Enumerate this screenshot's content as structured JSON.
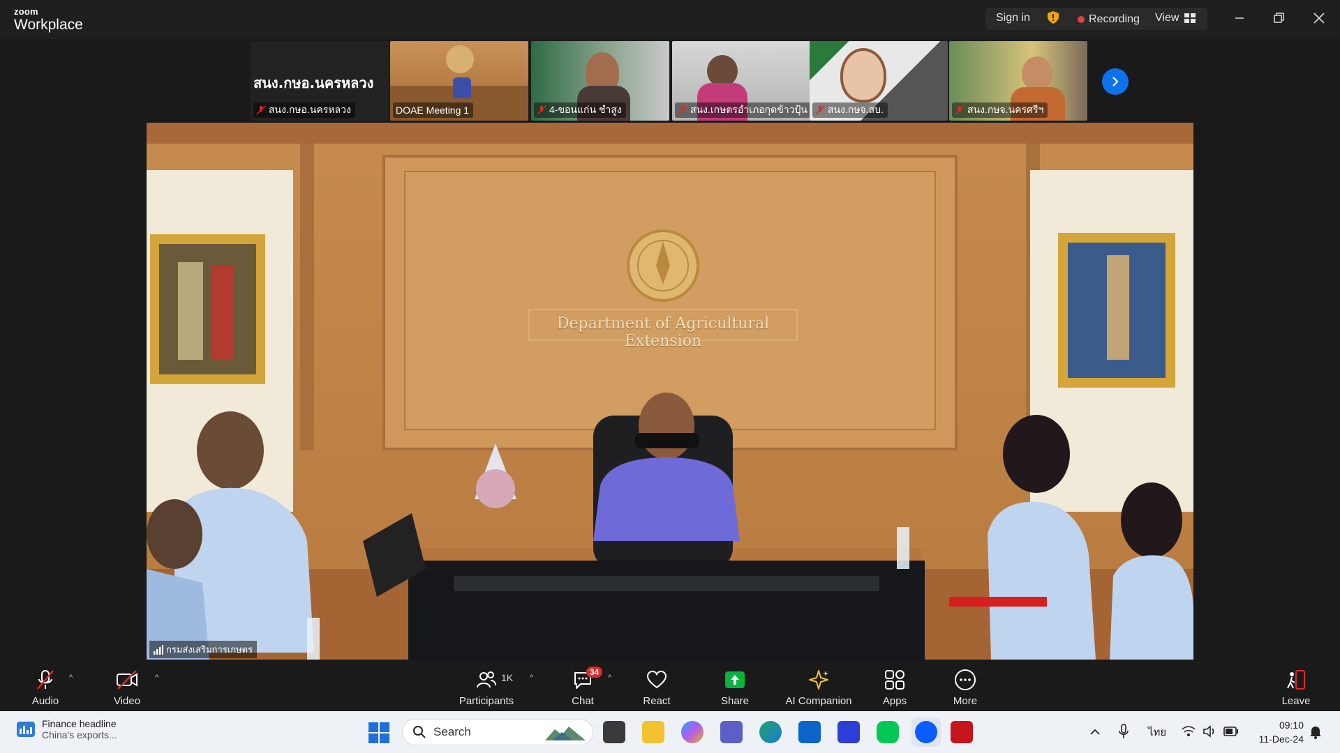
{
  "titlebar": {
    "logo_small": "zoom",
    "logo_big": "Workplace",
    "sign_in": "Sign in",
    "recording": "Recording",
    "view": "View"
  },
  "thumbnails": [
    {
      "name": "สนง.กษอ.นครหลวง",
      "banner": "สนง.กษอ.นครหลวง",
      "muted": true
    },
    {
      "name": "DOAE Meeting 1",
      "muted": false
    },
    {
      "name": "4-ขอนแก่น ชำสูง",
      "muted": true
    },
    {
      "name": "สนง.เกษตรอำเภอกุดข้าวปุ้น",
      "muted": true
    },
    {
      "name": "สนง.กษจ.สบ.",
      "muted": true
    },
    {
      "name": "สนง.กษจ.นครศรีฯ",
      "muted": true
    }
  ],
  "main_video": {
    "participant_name": "กรมส่งเสริมการเกษตร",
    "wall_sign": "Department of Agricultural Extension"
  },
  "toolbar": {
    "audio": "Audio",
    "video": "Video",
    "participants": "Participants",
    "participants_count": "1K",
    "chat": "Chat",
    "chat_badge": "34",
    "react": "React",
    "share": "Share",
    "ai_companion": "AI Companion",
    "apps": "Apps",
    "more": "More",
    "leave": "Leave"
  },
  "taskbar": {
    "widget_title": "Finance headline",
    "widget_sub": "China's exports...",
    "search_placeholder": "Search",
    "language": "ไทย",
    "time": "09:10",
    "date": "11-Dec-24"
  },
  "colors": {
    "accent_blue": "#0e72ed",
    "share_green": "#0ab33d",
    "recording_red": "#e0433a"
  }
}
